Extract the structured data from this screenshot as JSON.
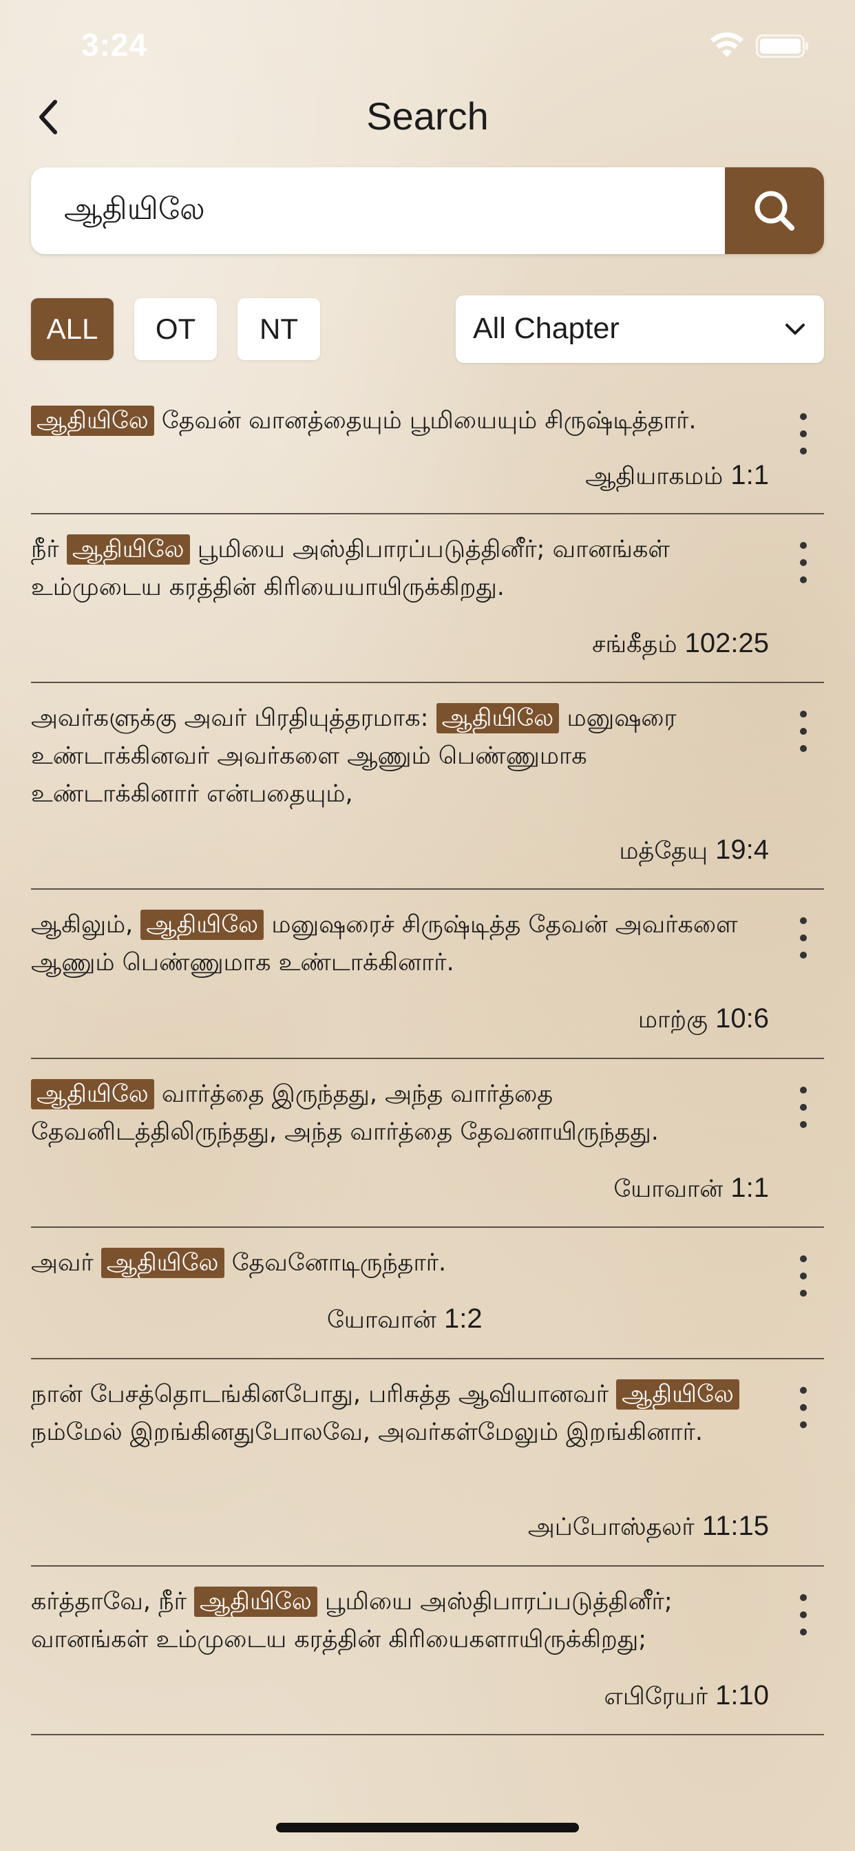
{
  "status_bar": {
    "time": "3:24"
  },
  "nav": {
    "title": "Search"
  },
  "search": {
    "value": "ஆதியிலே"
  },
  "filters": {
    "chips": [
      "ALL",
      "OT",
      "NT"
    ],
    "active": "ALL",
    "chapter_select": "All Chapter"
  },
  "results": [
    {
      "before": "",
      "highlight": "ஆதியிலே",
      "after": " தேவன் வானத்தையும் பூமியையும் சிருஷ்டித்தார்.",
      "book": "ஆதியாகமம்",
      "ref": "1:1"
    },
    {
      "before": "நீர் ",
      "highlight": "ஆதியிலே",
      "after": " பூமியை அஸ்திபாரப்படுத்தினீர்; வானங்கள் உம்முடைய கரத்தின் கிரியையாயிருக்கிறது.",
      "book": "சங்கீதம்",
      "ref": "102:25"
    },
    {
      "before": "அவர்களுக்கு அவர் பிரதியுத்தரமாக: ",
      "highlight": "ஆதியிலே",
      "after": " மனுஷரை உண்டாக்கினவர் அவர்களை ஆணும் பெண்ணுமாக உண்டாக்கினார் என்பதையும்,",
      "book": "மத்தேயு",
      "ref": "19:4"
    },
    {
      "before": "ஆகிலும், ",
      "highlight": "ஆதியிலே",
      "after": " மனுஷரைச் சிருஷ்டித்த தேவன் அவர்களை ஆணும் பெண்ணுமாக உண்டாக்கினார்.",
      "book": "மாற்கு",
      "ref": "10:6"
    },
    {
      "before": "",
      "highlight": "ஆதியிலே",
      "after": " வார்த்தை இருந்தது, அந்த வார்த்தை தேவனிடத்திலிருந்தது, அந்த வார்த்தை தேவனாயிருந்தது.",
      "book": "யோவான்",
      "ref": "1:1"
    },
    {
      "before": "அவர் ",
      "highlight": "ஆதியிலே",
      "after": " தேவனோடிருந்தார்.",
      "book": "யோவான்",
      "ref": "1:2"
    },
    {
      "before": "நான் பேசத்தொடங்கினபோது, பரிசுத்த ஆவியானவர் ",
      "highlight": "ஆதியிலே",
      "after": " நம்மேல் இறங்கினதுபோலவே, அவர்கள்மேலும் இறங்கினார்.",
      "book": "அப்போஸ்தலர்",
      "ref": "11:15"
    },
    {
      "before": "கர்த்தாவே, நீர் ",
      "highlight": "ஆதியிலே",
      "after": " பூமியை அஸ்திபாரப்படுத்தினீர்; வானங்கள் உம்முடைய கரத்தின் கிரியைகளாயிருக்கிறது;",
      "book": "எபிரேயர்",
      "ref": "1:10"
    }
  ]
}
